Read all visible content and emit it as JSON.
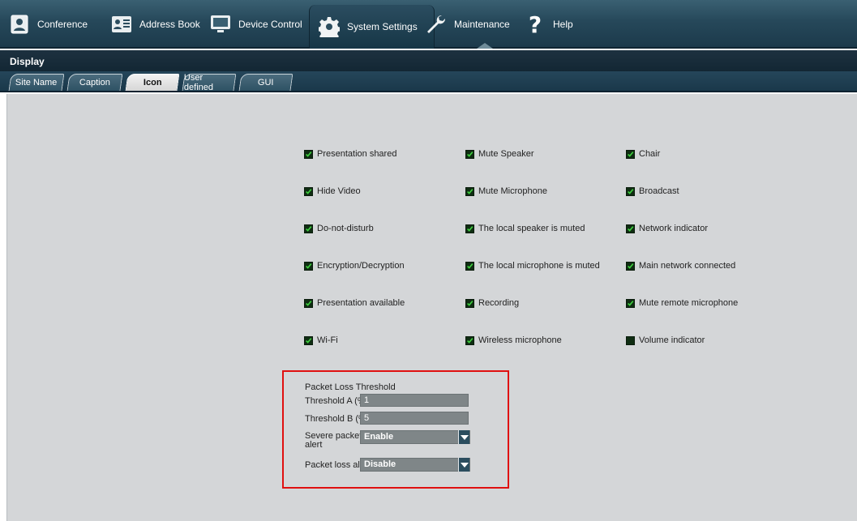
{
  "nav": {
    "conference": "Conference",
    "address_book": "Address Book",
    "device_control": "Device Control",
    "system_settings": "System Settings",
    "maintenance": "Maintenance",
    "help": "Help"
  },
  "section": {
    "title": "Display"
  },
  "subtabs": [
    "Site Name",
    "Caption",
    "Icon",
    "User defined",
    "GUI"
  ],
  "icons": [
    {
      "label": "Presentation shared",
      "checked": true
    },
    {
      "label": "Mute Speaker",
      "checked": true
    },
    {
      "label": "Chair",
      "checked": true
    },
    {
      "label": "Hide Video",
      "checked": true
    },
    {
      "label": "Mute Microphone",
      "checked": true
    },
    {
      "label": "Broadcast",
      "checked": true
    },
    {
      "label": "Do-not-disturb",
      "checked": true
    },
    {
      "label": "The local speaker is muted",
      "checked": true
    },
    {
      "label": "Network indicator",
      "checked": true
    },
    {
      "label": "Encryption/Decryption",
      "checked": true
    },
    {
      "label": "The local microphone is muted",
      "checked": true
    },
    {
      "label": "Main network connected",
      "checked": true
    },
    {
      "label": "Presentation available",
      "checked": true
    },
    {
      "label": "Recording",
      "checked": true
    },
    {
      "label": "Mute remote microphone",
      "checked": true
    },
    {
      "label": "Wi-Fi",
      "checked": true
    },
    {
      "label": "Wireless microphone",
      "checked": true
    },
    {
      "label": "Volume indicator",
      "checked": false
    }
  ],
  "packet_loss": {
    "title": "Packet Loss Threshold",
    "threshold_a_label": "Threshold A (%)",
    "threshold_a_value": "1",
    "threshold_b_label": "Threshold B (%)",
    "threshold_b_value": "5",
    "severe_label_line1": "Severe packet loss",
    "severe_label_line2": "alert",
    "severe_value": "Enable",
    "alarm_label": "Packet loss alarm",
    "alarm_value": "Disable"
  },
  "colors": {
    "highlight_border": "#e01010",
    "check_green": "#3fd13f"
  }
}
